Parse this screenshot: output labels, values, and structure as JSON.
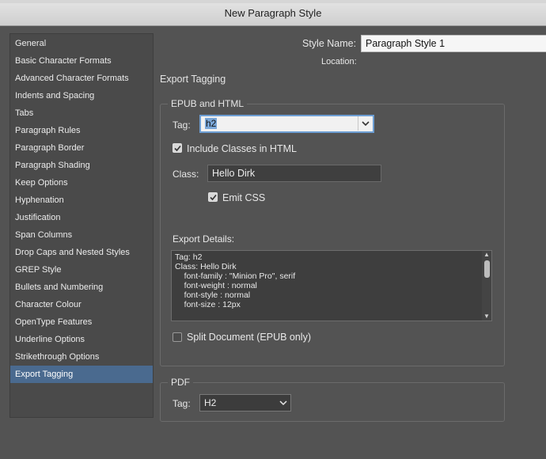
{
  "window": {
    "title": "New Paragraph Style"
  },
  "sidebar": {
    "items": [
      {
        "label": "General"
      },
      {
        "label": "Basic Character Formats"
      },
      {
        "label": "Advanced Character Formats"
      },
      {
        "label": "Indents and Spacing"
      },
      {
        "label": "Tabs"
      },
      {
        "label": "Paragraph Rules"
      },
      {
        "label": "Paragraph Border"
      },
      {
        "label": "Paragraph Shading"
      },
      {
        "label": "Keep Options"
      },
      {
        "label": "Hyphenation"
      },
      {
        "label": "Justification"
      },
      {
        "label": "Span Columns"
      },
      {
        "label": "Drop Caps and Nested Styles"
      },
      {
        "label": "GREP Style"
      },
      {
        "label": "Bullets and Numbering"
      },
      {
        "label": "Character Colour"
      },
      {
        "label": "OpenType Features"
      },
      {
        "label": "Underline Options"
      },
      {
        "label": "Strikethrough Options"
      },
      {
        "label": "Export Tagging",
        "selected": true
      }
    ]
  },
  "header": {
    "style_name_label": "Style Name:",
    "style_name_value": "Paragraph Style 1",
    "location_label": "Location:"
  },
  "panel": {
    "title": "Export Tagging",
    "epub": {
      "group_label": "EPUB and HTML",
      "tag_label": "Tag:",
      "tag_value": "h2",
      "include_classes_label": "Include Classes in HTML",
      "include_classes_checked": true,
      "class_label": "Class:",
      "class_value": "Hello Dirk",
      "emit_css_label": "Emit CSS",
      "emit_css_checked": true,
      "export_details_label": "Export Details:",
      "export_details_lines": [
        "Tag: h2",
        "Class: Hello Dirk",
        "    font-family : \"Minion Pro\", serif",
        "    font-weight : normal",
        "    font-style : normal",
        "    font-size : 12px"
      ],
      "split_document_label": "Split Document (EPUB only)",
      "split_document_checked": false
    },
    "pdf": {
      "group_label": "PDF",
      "tag_label": "Tag:",
      "tag_value": "H2"
    }
  },
  "icons": {
    "dropdown": "chevron-down-icon",
    "checkmark": "checkmark-icon",
    "scroll_up": "scroll-up-arrow-icon",
    "scroll_down": "scroll-down-arrow-icon"
  },
  "colors": {
    "background": "#535353",
    "selection": "#4a6a8f",
    "focus": "#6d9ed3"
  }
}
